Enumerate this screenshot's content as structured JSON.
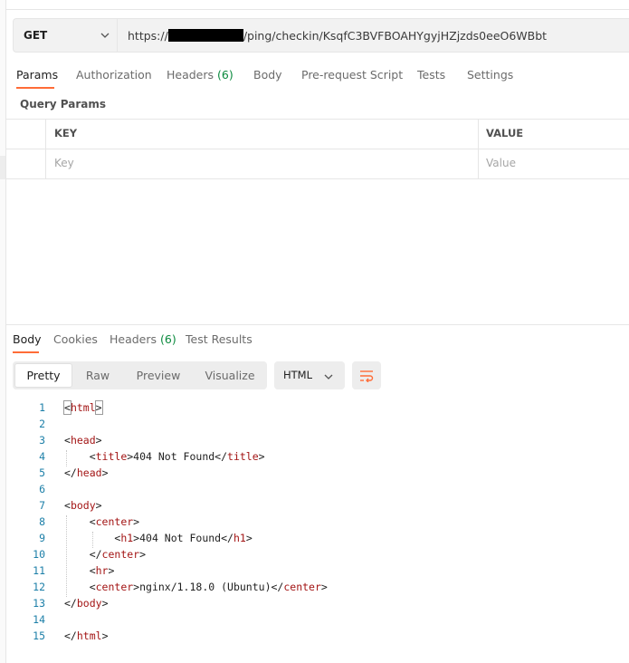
{
  "request": {
    "method": "GET",
    "url_prefix": "https://",
    "url_suffix": "/ping/checkin/KsqfC3BVFBOAHYgyjHZjzds0eeO6WBbt"
  },
  "request_tabs": [
    {
      "label": "Params",
      "count": ""
    },
    {
      "label": "Authorization",
      "count": ""
    },
    {
      "label": "Headers",
      "count": "(6)"
    },
    {
      "label": "Body",
      "count": ""
    },
    {
      "label": "Pre-request Script",
      "count": ""
    },
    {
      "label": "Tests",
      "count": ""
    },
    {
      "label": "Settings",
      "count": ""
    }
  ],
  "query_params": {
    "title": "Query Params",
    "key_header": "KEY",
    "value_header": "VALUE",
    "key_placeholder": "Key",
    "value_placeholder": "Value"
  },
  "response_tabs": [
    {
      "label": "Body",
      "count": ""
    },
    {
      "label": "Cookies",
      "count": ""
    },
    {
      "label": "Headers",
      "count": "(6)"
    },
    {
      "label": "Test Results",
      "count": ""
    }
  ],
  "view_modes": [
    "Pretty",
    "Raw",
    "Preview",
    "Visualize"
  ],
  "format": "HTML",
  "code_lines": [
    {
      "n": "1",
      "t": "<html>"
    },
    {
      "n": "2",
      "t": ""
    },
    {
      "n": "3",
      "t": "<head>"
    },
    {
      "n": "4",
      "t": "    <title>404 Not Found</title>"
    },
    {
      "n": "5",
      "t": "</head>"
    },
    {
      "n": "6",
      "t": ""
    },
    {
      "n": "7",
      "t": "<body>"
    },
    {
      "n": "8",
      "t": "    <center>"
    },
    {
      "n": "9",
      "t": "        <h1>404 Not Found</h1>"
    },
    {
      "n": "10",
      "t": "    </center>"
    },
    {
      "n": "11",
      "t": "    <hr>"
    },
    {
      "n": "12",
      "t": "    <center>nginx/1.18.0 (Ubuntu)</center>"
    },
    {
      "n": "13",
      "t": "</body>"
    },
    {
      "n": "14",
      "t": ""
    },
    {
      "n": "15",
      "t": "</html>"
    }
  ]
}
